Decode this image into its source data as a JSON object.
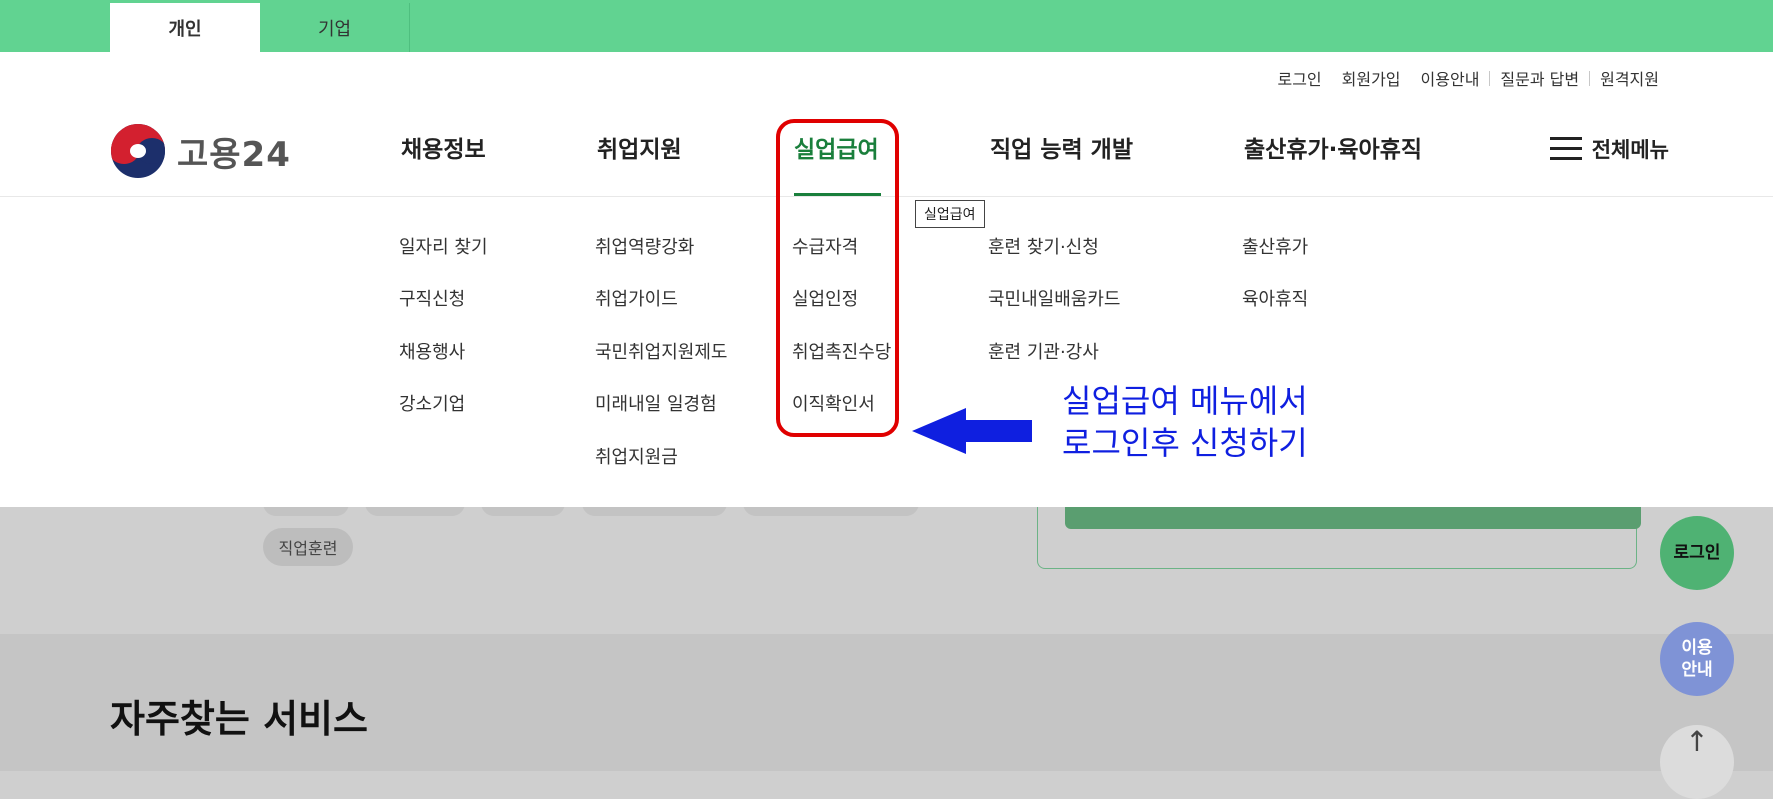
{
  "top_tabs": [
    {
      "label": "개인",
      "active": true
    },
    {
      "label": "기업",
      "active": false
    }
  ],
  "util_links": [
    "로그인",
    "회원가입",
    "이용안내",
    "질문과 답변",
    "원격지원"
  ],
  "logo": {
    "text": "고용24"
  },
  "gnb": [
    {
      "label": "채용정보",
      "items": [
        "일자리 찾기",
        "구직신청",
        "채용행사",
        "강소기업"
      ]
    },
    {
      "label": "취업지원",
      "items": [
        "취업역량강화",
        "취업가이드",
        "국민취업지원제도",
        "미래내일 일경험",
        "취업지원금"
      ]
    },
    {
      "label": "실업급여",
      "active": true,
      "items": [
        "수급자격",
        "실업인정",
        "취업촉진수당",
        "이직확인서"
      ]
    },
    {
      "label": "직업 능력 개발",
      "items": [
        "훈련 찾기·신청",
        "국민내일배움카드",
        "훈련 기관·강사"
      ]
    },
    {
      "label": "출산휴가·육아휴직",
      "items": [
        "출산휴가",
        "육아휴직"
      ]
    }
  ],
  "all_menu_label": "전체메뉴",
  "tooltip": "실업급여",
  "annotation": {
    "line1": "실업급여 메뉴에서",
    "line2": "로그인후 신청하기",
    "color": "#0f1fe0"
  },
  "pill_tag": "직업훈련",
  "section_title": "자주찾는 서비스",
  "floating": {
    "login": "로그인",
    "guide_line1": "이용",
    "guide_line2": "안내",
    "top": "↑"
  },
  "colors": {
    "green_bar": "#61d391",
    "active_green": "#1a7f3c",
    "highlight_red": "#e00000",
    "arrow_blue": "#0f1fe0"
  }
}
